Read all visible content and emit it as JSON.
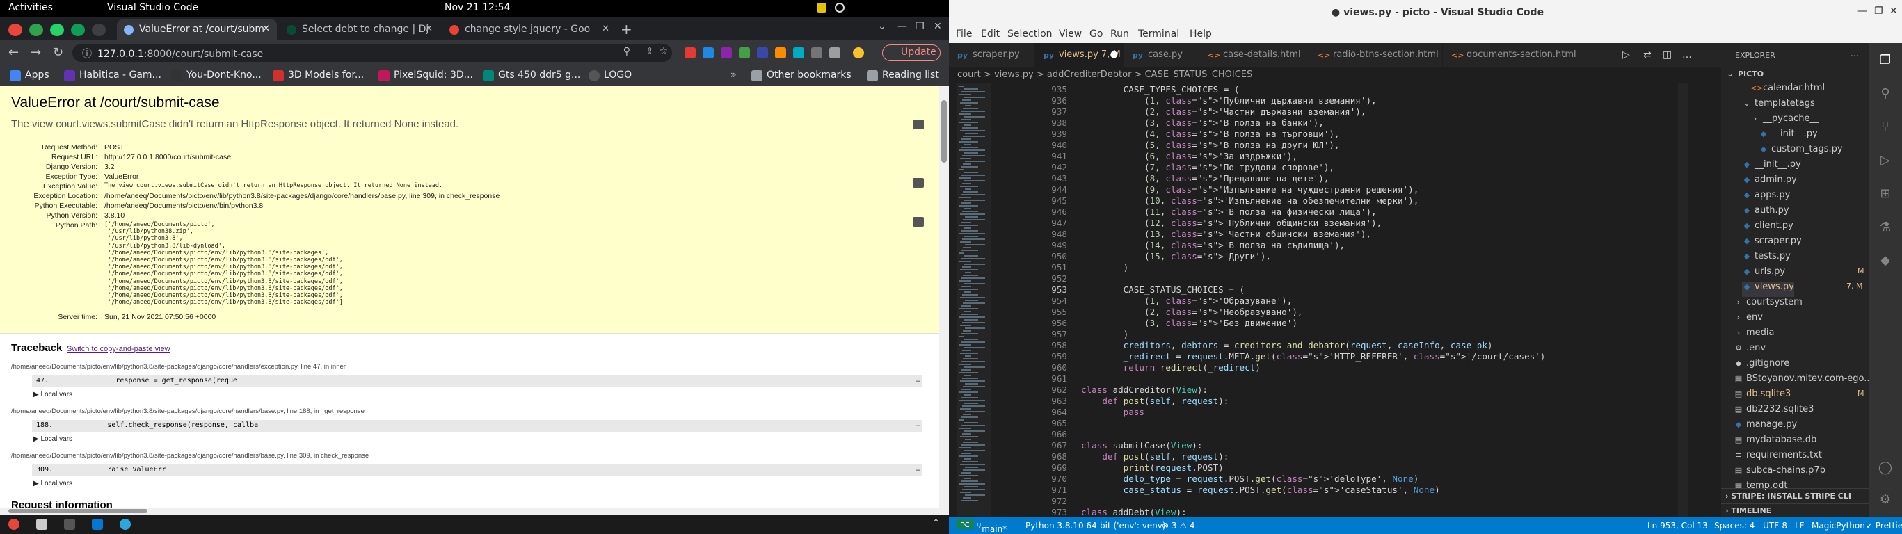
{
  "topbar": {
    "activities": "Activities",
    "app": "Visual Studio Code",
    "clock": "Nov 21  12:54"
  },
  "chrome": {
    "tabs": [
      {
        "title": "ValueError at /court/subm",
        "active": true
      },
      {
        "title": "Select debt to change | Dj"
      },
      {
        "title": "change style jquery - Goo"
      }
    ],
    "url_host": "127.0.0.1",
    "url_path": ":8000/court/submit-case",
    "update_label": "Update",
    "bookmarks": [
      "Apps",
      "Habitica - Gam...",
      "You-Dont-Kno...",
      "3D Models for...",
      "PixelSquid: 3D...",
      "Gts 450 ddr5 g...",
      "LOGO"
    ],
    "other_bookmarks": "Other bookmarks",
    "reading_list": "Reading list"
  },
  "django": {
    "title": "ValueError at /court/submit-case",
    "subtitle": "The view court.views.submitCase didn't return an HttpResponse object. It returned None instead.",
    "meta": [
      {
        "k": "Request Method:",
        "v": "POST"
      },
      {
        "k": "Request URL:",
        "v": "http://127.0.0.1:8000/court/submit-case"
      },
      {
        "k": "Django Version:",
        "v": "3.2"
      },
      {
        "k": "Exception Type:",
        "v": "ValueError"
      },
      {
        "k": "Exception Value:",
        "v": "The view court.views.submitCase didn't return an HttpResponse object. It returned None instead."
      },
      {
        "k": "Exception Location:",
        "v": "/home/aneeq/Documents/picto/env/lib/python3.8/site-packages/django/core/handlers/base.py, line 309, in check_response"
      },
      {
        "k": "Python Executable:",
        "v": "/home/aneeq/Documents/picto/env/bin/python3.8"
      },
      {
        "k": "Python Version:",
        "v": "3.8.10"
      },
      {
        "k": "Python Path:",
        "v": ""
      }
    ],
    "python_path": "['/home/aneeq/Documents/picto',\n '/usr/lib/python38.zip',\n '/usr/lib/python3.8',\n '/usr/lib/python3.8/lib-dynload',\n '/home/aneeq/Documents/picto/env/lib/python3.8/site-packages',\n '/home/aneeq/Documents/picto/env/lib/python3.8/site-packages/odf',\n '/home/aneeq/Documents/picto/env/lib/python3.8/site-packages/odf',\n '/home/aneeq/Documents/picto/env/lib/python3.8/site-packages/odf',\n '/home/aneeq/Documents/picto/env/lib/python3.8/site-packages/odf',\n '/home/aneeq/Documents/picto/env/lib/python3.8/site-packages/odf',\n '/home/aneeq/Documents/picto/env/lib/python3.8/site-packages/odf',\n '/home/aneeq/Documents/picto/env/lib/python3.8/site-packages/odf']",
    "server_time_k": "Server time:",
    "server_time_v": "Sun, 21 Nov 2021 07:50:56 +0000",
    "traceback": "Traceback",
    "traceback_link": "Switch to copy-and-paste view",
    "frames": [
      {
        "file": "/home/aneeq/Documents/picto/env/lib/python3.8/site-packages/django/core/handlers/exception.py, line 47, in inner",
        "code": "47.                response = get_response(reque"
      },
      {
        "file": "/home/aneeq/Documents/picto/env/lib/python3.8/site-packages/django/core/handlers/base.py, line 188, in _get_response",
        "code": "188.             self.check_response(response, callba"
      },
      {
        "file": "/home/aneeq/Documents/picto/env/lib/python3.8/site-packages/django/core/handlers/base.py, line 309, in check_response",
        "code": "309.             raise ValueErr"
      }
    ],
    "local_vars": "▶ Local vars",
    "ellipsis": "…",
    "request_info": "Request information"
  },
  "vscode": {
    "title": "● views.py - picto - Visual Studio Code",
    "menu": [
      "File",
      "Edit",
      "Selection",
      "View",
      "Go",
      "Run",
      "Terminal",
      "Help"
    ],
    "tabs": [
      {
        "name": "scraper.py",
        "icon": "py"
      },
      {
        "name": "views.py 7, M",
        "icon": "py",
        "active": true
      },
      {
        "name": "case.py",
        "icon": "py"
      },
      {
        "name": "case-details.html",
        "icon": "<>"
      },
      {
        "name": "radio-btns-section.html",
        "icon": "<>"
      },
      {
        "name": "documents-section.html",
        "icon": "<>"
      }
    ],
    "breadcrumb": "court > views.py > addCrediterDebtor > CASE_STATUS_CHOICES",
    "lines": [
      {
        "n": "935",
        "c": "        CASE_TYPES_CHOICES = ("
      },
      {
        "n": "936",
        "c": "            (1, 'Публични държавни вземания'),"
      },
      {
        "n": "937",
        "c": "            (2, 'Частни държавни вземания'),"
      },
      {
        "n": "938",
        "c": "            (3, 'В полза на банки'),"
      },
      {
        "n": "939",
        "c": "            (4, 'В полза на търговци'),"
      },
      {
        "n": "940",
        "c": "            (5, 'В полза на други ЮЛ'),"
      },
      {
        "n": "941",
        "c": "            (6, 'За издръжки'),"
      },
      {
        "n": "942",
        "c": "            (7, 'По трудови спорове'),"
      },
      {
        "n": "943",
        "c": "            (8, 'Предаване на дете'),"
      },
      {
        "n": "944",
        "c": "            (9, 'Изпълнение на чуждестранни решения'),"
      },
      {
        "n": "945",
        "c": "            (10, 'Изпълнение на обезпечителни мерки'),"
      },
      {
        "n": "946",
        "c": "            (11, 'В полза на физически лица'),"
      },
      {
        "n": "947",
        "c": "            (12, 'Публични общински вземания'),"
      },
      {
        "n": "948",
        "c": "            (13, 'Частни общински вземания'),"
      },
      {
        "n": "949",
        "c": "            (14, 'В полза на съдилища'),"
      },
      {
        "n": "950",
        "c": "            (15, 'Други'),"
      },
      {
        "n": "951",
        "c": "        )"
      },
      {
        "n": "952",
        "c": ""
      },
      {
        "n": "953",
        "c": "        CASE_STATUS_CHOICES = ("
      },
      {
        "n": "954",
        "c": "            (1, 'Образуване'),"
      },
      {
        "n": "955",
        "c": "            (2, 'Необразувано'),"
      },
      {
        "n": "956",
        "c": "            (3, 'Без движение')"
      },
      {
        "n": "957",
        "c": "        )"
      },
      {
        "n": "958",
        "c": "        creditors, debtors = creditors_and_debator(request, caseInfo, case_pk)"
      },
      {
        "n": "959",
        "c": "        _redirect = request.META.get('HTTP_REFERER', '/court/cases')"
      },
      {
        "n": "960",
        "c": "        return redirect(_redirect)"
      },
      {
        "n": "961",
        "c": ""
      },
      {
        "n": "962",
        "c": "class addCreditor(View):"
      },
      {
        "n": "963",
        "c": "    def post(self, request):"
      },
      {
        "n": "964",
        "c": "        pass"
      },
      {
        "n": "965",
        "c": ""
      },
      {
        "n": "966",
        "c": ""
      },
      {
        "n": "967",
        "c": "class submitCase(View):"
      },
      {
        "n": "968",
        "c": "    def post(self, request):"
      },
      {
        "n": "969",
        "c": "        print(request.POST)"
      },
      {
        "n": "970",
        "c": "        delo_type = request.POST.get('deloType', None)"
      },
      {
        "n": "971",
        "c": "        case_status = request.POST.get('caseStatus', None)"
      },
      {
        "n": "972",
        "c": ""
      },
      {
        "n": "973",
        "c": "class addDebt(View):"
      }
    ],
    "explorer_title": "EXPLORER",
    "tree": [
      {
        "label": "PICTO",
        "indent": 0,
        "bold": true,
        "ic": "⌄"
      },
      {
        "label": "calendar.html",
        "indent": 3,
        "ic": "<>",
        "color": "#e37933"
      },
      {
        "label": "templatetags",
        "indent": 2,
        "ic": "⌄"
      },
      {
        "label": "__pycache__",
        "indent": 3,
        "ic": "›"
      },
      {
        "label": "__init__.py",
        "indent": 4,
        "ic": "py",
        "color": "#3572a5"
      },
      {
        "label": "custom_tags.py",
        "indent": 4,
        "ic": "py",
        "color": "#3572a5"
      },
      {
        "label": "__init__.py",
        "indent": 2,
        "ic": "py",
        "color": "#3572a5"
      },
      {
        "label": "admin.py",
        "indent": 2,
        "ic": "py",
        "color": "#3572a5"
      },
      {
        "label": "apps.py",
        "indent": 2,
        "ic": "py",
        "color": "#3572a5"
      },
      {
        "label": "auth.py",
        "indent": 2,
        "ic": "py",
        "color": "#3572a5"
      },
      {
        "label": "client.py",
        "indent": 2,
        "ic": "py",
        "color": "#3572a5"
      },
      {
        "label": "scraper.py",
        "indent": 2,
        "ic": "py",
        "color": "#3572a5"
      },
      {
        "label": "tests.py",
        "indent": 2,
        "ic": "py",
        "color": "#3572a5"
      },
      {
        "label": "urls.py",
        "indent": 2,
        "ic": "py",
        "color": "#3572a5",
        "badge": "M"
      },
      {
        "label": "views.py",
        "indent": 2,
        "ic": "py",
        "color": "#3572a5",
        "badge": "7, M",
        "mod": true
      },
      {
        "label": "courtsystem",
        "indent": 1,
        "ic": "›"
      },
      {
        "label": "env",
        "indent": 1,
        "ic": "›"
      },
      {
        "label": "media",
        "indent": 1,
        "ic": "›"
      },
      {
        "label": ".env",
        "indent": 1,
        "ic": "⚙"
      },
      {
        "label": ".gitignore",
        "indent": 1,
        "ic": "◆"
      },
      {
        "label": "BStoyanov.mitev.com-ego...",
        "indent": 1,
        "ic": "▤"
      },
      {
        "label": "db.sqlite3",
        "indent": 1,
        "ic": "▤",
        "badge": "M",
        "mod2": true
      },
      {
        "label": "db2232.sqlite3",
        "indent": 1,
        "ic": "▤"
      },
      {
        "label": "manage.py",
        "indent": 1,
        "ic": "py",
        "color": "#3572a5"
      },
      {
        "label": "mydatabase.db",
        "indent": 1,
        "ic": "▤"
      },
      {
        "label": "requirements.txt",
        "indent": 1,
        "ic": "≡"
      },
      {
        "label": "subca-chains.p7b",
        "indent": 1,
        "ic": "▤"
      },
      {
        "label": "temp.odt",
        "indent": 1,
        "ic": "▤"
      }
    ],
    "stripe": "STRIPE: INSTALL STRIPE CLI",
    "timeline": "TIMELINE",
    "status": {
      "branch": "main*",
      "python": "Python 3.8.10 64-bit ('env': venv)",
      "problems": "⊗ 3 ⚠ 4",
      "pos": "Ln 953, Col 13",
      "spaces": "Spaces: 4",
      "enc": "UTF-8",
      "eol": "LF",
      "lang": "MagicPython",
      "prettier": "✓ Prettier"
    }
  }
}
